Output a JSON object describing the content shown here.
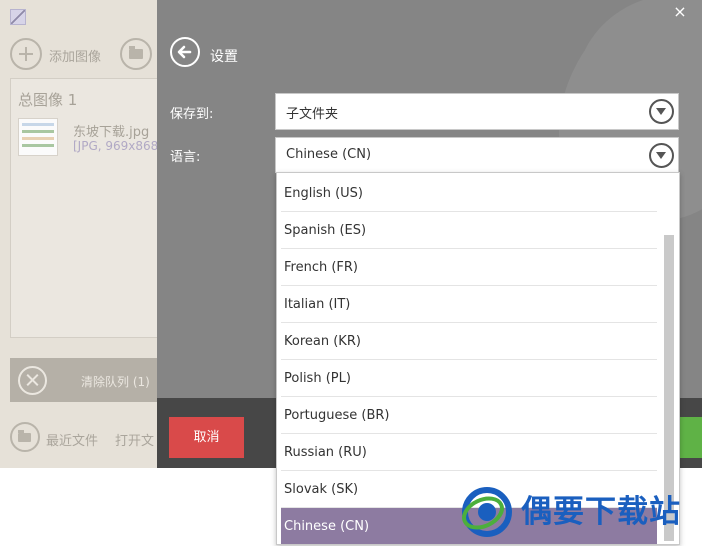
{
  "left_app": {
    "add_label": "添加图像",
    "queue_title": "总图像 1",
    "file_name": "东坡下载.jpg",
    "file_meta": "[JPG, 969x868,",
    "clear_label": "清除队列 (1)",
    "recent_label": "最近文件",
    "open_label": "打开文"
  },
  "settings": {
    "title": "设置",
    "save_to_label": "保存到:",
    "save_to_value": "子文件夹",
    "language_label": "语言:",
    "language_value": "Chinese (CN)",
    "cancel_label": "取消",
    "close_glyph": "×",
    "language_options": [
      "English (US)",
      "Spanish (ES)",
      "French (FR)",
      "Italian (IT)",
      "Korean (KR)",
      "Polish (PL)",
      "Portuguese (BR)",
      "Russian (RU)",
      "Slovak (SK)",
      "Chinese (CN)"
    ],
    "selected_index": 9
  },
  "watermark": {
    "text": "偶要下载站"
  },
  "colors": {
    "overlay": "#858585",
    "bottom_bar": "#474747",
    "cancel": "#d94a4a",
    "selected_option": "#8d7ba1",
    "confirm": "#5fb246",
    "watermark": "#1a5fbf"
  }
}
